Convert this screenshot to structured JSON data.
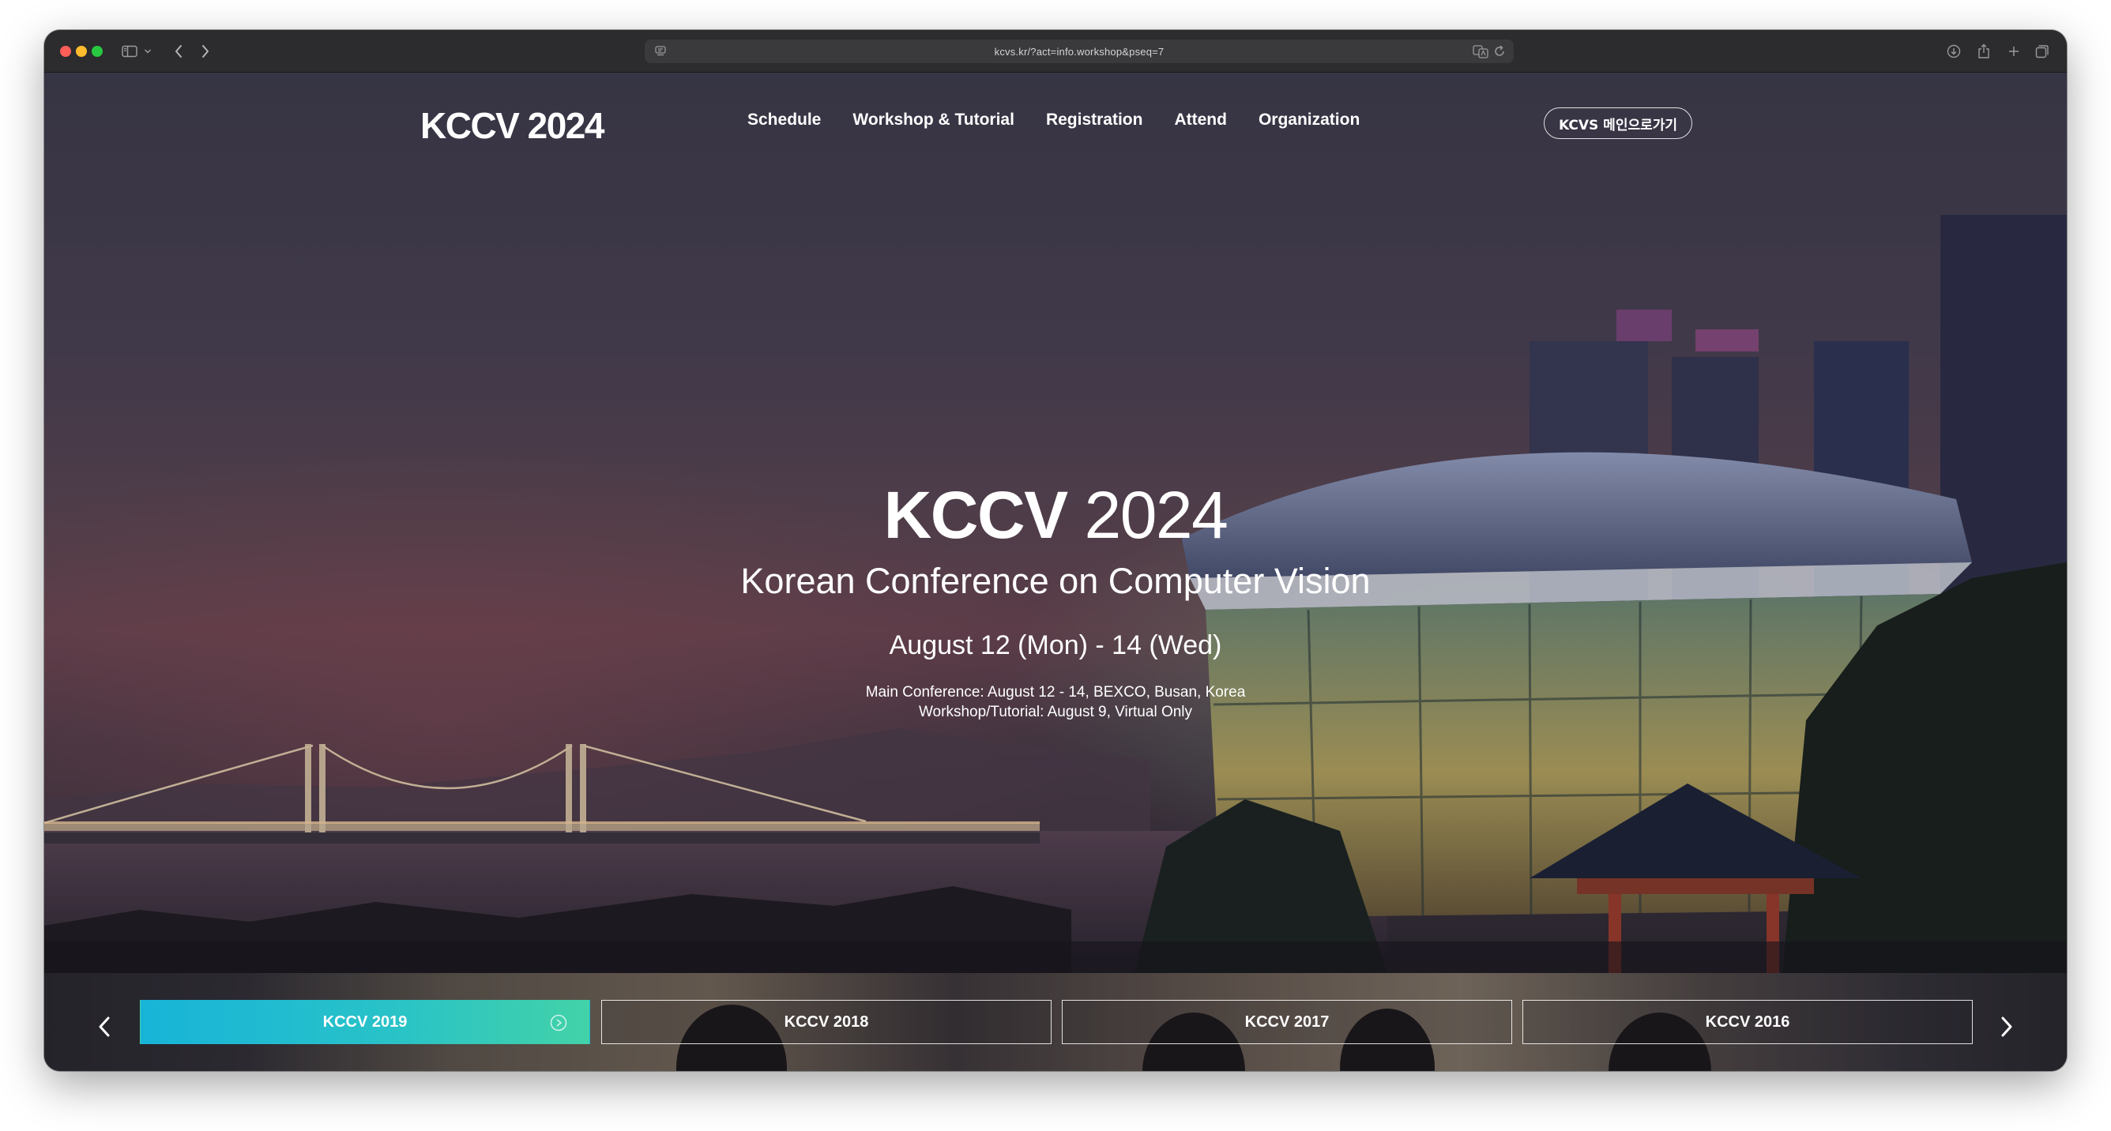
{
  "browser": {
    "url": "kcvs.kr/?act=info.workshop&pseq=7",
    "icons": [
      "sidebar-icon",
      "chevron-down-icon",
      "back-icon",
      "forward-icon",
      "page-settings-icon",
      "translate-icon",
      "reload-icon",
      "download-icon",
      "share-icon",
      "new-tab-icon",
      "tab-overview-icon"
    ]
  },
  "header": {
    "logo": "KCCV 2024",
    "nav": [
      {
        "label": "Schedule"
      },
      {
        "label": "Workshop & Tutorial"
      },
      {
        "label": "Registration"
      },
      {
        "label": "Attend"
      },
      {
        "label": "Organization"
      }
    ],
    "kcvs_button": "KCVS 메인으로가기"
  },
  "hero": {
    "title_bold": "KCCV",
    "title_year": "2024",
    "subtitle": "Korean Conference on Computer Vision",
    "date": "August 12 (Mon) - 14 (Wed)",
    "main_conference": "Main Conference: August 12 - 14, BEXCO, Busan, Korea",
    "workshop": "Workshop/Tutorial: August 9, Virtual Only"
  },
  "past_events": {
    "selected_index": 0,
    "tabs": [
      {
        "label": "KCCV 2019"
      },
      {
        "label": "KCCV 2018"
      },
      {
        "label": "KCCV 2017"
      },
      {
        "label": "KCCV 2016"
      }
    ]
  },
  "colors": {
    "active_tab_start": "#18b4d8",
    "active_tab_end": "#43d2a8",
    "text": "#ffffff"
  }
}
